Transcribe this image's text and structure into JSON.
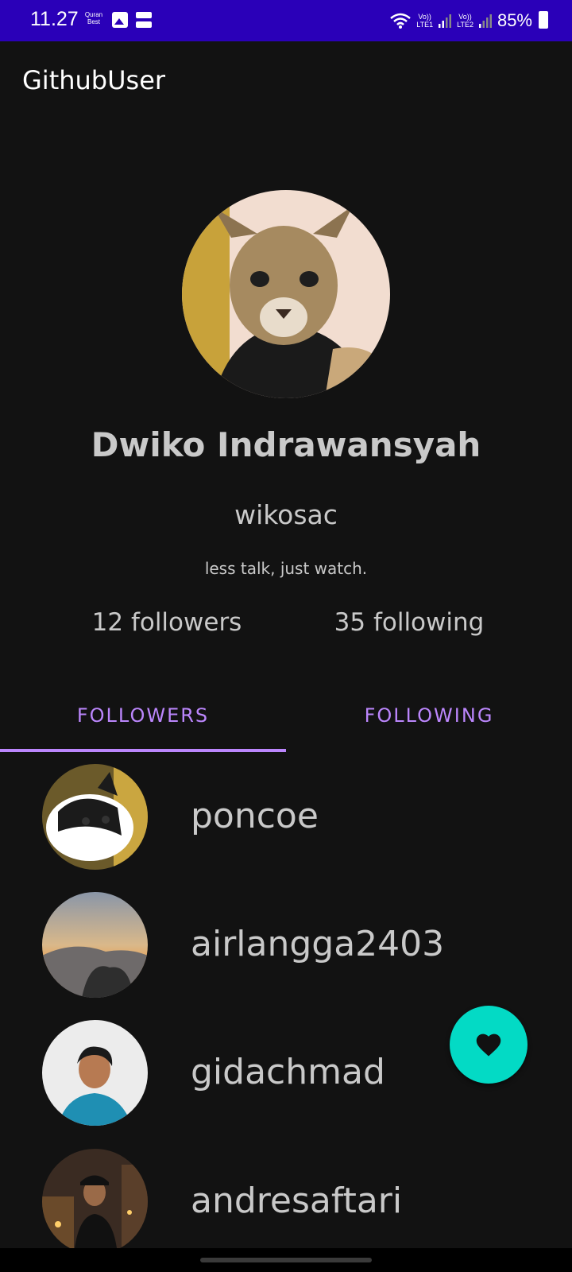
{
  "status_bar": {
    "time": "11.27",
    "quran_line1": "Quran",
    "quran_line2": "Best",
    "lte1_top": "Vo))",
    "lte1_bottom": "LTE1",
    "lte2_top": "Vo))",
    "lte2_bottom": "LTE2",
    "battery": "85%"
  },
  "app_bar": {
    "title": "GithubUser"
  },
  "profile": {
    "name": "Dwiko Indrawansyah",
    "username": "wikosac",
    "bio": "less talk, just watch.",
    "followers": "12 followers",
    "following": "35 following"
  },
  "tabs": [
    {
      "label": "FOLLOWERS",
      "selected": true
    },
    {
      "label": "FOLLOWING",
      "selected": false
    }
  ],
  "list": [
    {
      "username": "poncoe"
    },
    {
      "username": "airlangga2403"
    },
    {
      "username": "gidachmad"
    },
    {
      "username": "andresaftari"
    }
  ],
  "fab": {
    "icon": "heart-icon"
  },
  "colors": {
    "status_bar": "#2a00b8",
    "background": "#121212",
    "accent": "#bb86fc",
    "fab": "#03dac5",
    "text": "#c9c9c9"
  }
}
